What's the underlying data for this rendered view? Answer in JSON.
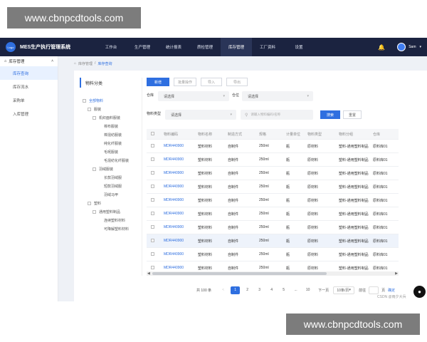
{
  "watermark": "www.cbnpcdtools.com",
  "app": {
    "logo": "Logo",
    "title": "MES生产执行管理系统"
  },
  "nav": {
    "tabs": [
      "工作台",
      "生产管理",
      "统计报表",
      "质检管理",
      "库存管理",
      "工厂资料",
      "设置"
    ],
    "active": "库存管理",
    "user": "Sam"
  },
  "sidebar": {
    "group": "库存管理",
    "items": [
      "库存查询",
      "库存流水",
      "采购单",
      "入库管理"
    ],
    "active": "库存查询"
  },
  "breadcrumb": {
    "parent": "库存管理",
    "sep": "/",
    "current": "库存查询"
  },
  "tree": {
    "title": "物料分类",
    "nodes": [
      "全部物料",
      "服装",
      "机织面料服装",
      "棉布服装",
      "棉混纺服装",
      "纯化纤服装",
      "毛呢服装",
      "毛混纺化纤服装",
      "羽绒服装",
      "长款羽绒服",
      "短款羽绒服",
      "羽绒马甲",
      "塑料",
      "通用塑料制品",
      "连续塑料材料",
      "可降解塑料材料"
    ]
  },
  "actions": {
    "add": "新增",
    "batch": "批量操作",
    "import": "导入",
    "export": "导出"
  },
  "filters": {
    "warehouse_label": "仓库",
    "warehouse_value": "请选择",
    "location_label": "仓位",
    "location_value": "请选择",
    "type_label": "物料类型",
    "type_value": "请选择",
    "search_placeholder": "请输入物料编码/名称",
    "search_btn": "搜索",
    "reset_btn": "重置"
  },
  "table": {
    "headers": [
      "物料编码",
      "物料名称",
      "制造方式",
      "规格",
      "计量单位",
      "物料类型",
      "物料分组",
      "仓库"
    ],
    "rows": [
      [
        "MDR440900",
        "塑料材料",
        "自制件",
        "250ml",
        "瓶",
        "原材料",
        "塑料-通用塑料制品",
        "原料库01"
      ],
      [
        "MDR440900",
        "塑料材料",
        "自制件",
        "250ml",
        "瓶",
        "原材料",
        "塑料-通用塑料制品",
        "原料库01"
      ],
      [
        "MDR440900",
        "塑料材料",
        "自制件",
        "250ml",
        "瓶",
        "原材料",
        "塑料-通用塑料制品",
        "原料库01"
      ],
      [
        "MDR440900",
        "塑料材料",
        "自制件",
        "250ml",
        "瓶",
        "原材料",
        "塑料-通用塑料制品",
        "原料库01"
      ],
      [
        "MDR440900",
        "塑料材料",
        "自制件",
        "250ml",
        "瓶",
        "原材料",
        "塑料-通用塑料制品",
        "原料库01"
      ],
      [
        "MDR440900",
        "塑料材料",
        "自制件",
        "250ml",
        "瓶",
        "原材料",
        "塑料-通用塑料制品",
        "原料库01"
      ],
      [
        "MDR440900",
        "塑料材料",
        "自制件",
        "250ml",
        "瓶",
        "原材料",
        "塑料-通用塑料制品",
        "原料库01"
      ],
      [
        "MDR440900",
        "塑料材料",
        "自制件",
        "250ml",
        "瓶",
        "原材料",
        "塑料-通用塑料制品",
        "原料库01"
      ],
      [
        "MDR440900",
        "塑料材料",
        "自制件",
        "250ml",
        "瓶",
        "原材料",
        "塑料-通用塑料制品",
        "原料库01"
      ],
      [
        "MDR440900",
        "塑料材料",
        "自制件",
        "250ml",
        "瓶",
        "原材料",
        "塑料-通用塑料制品",
        "原料库01"
      ]
    ],
    "highlight_row": 7
  },
  "pagination": {
    "total": "共 100 条",
    "prev": "<",
    "pages": [
      "1",
      "2",
      "3",
      "4",
      "5",
      "...",
      "10"
    ],
    "active": "1",
    "next": "下一页",
    "size": "10条/页",
    "goto_label": "前往",
    "goto_unit": "页",
    "confirm": "确定"
  },
  "footer": {
    "csdn": "CSDN @雨夕大兵"
  },
  "colors": {
    "accent": "#2f6fe0",
    "nav_bg": "#1b2340",
    "link": "#2f6fe0"
  },
  "icons": {
    "bell": "bell-icon",
    "search": "search-icon",
    "chat": "chat-icon",
    "home": "home-icon"
  }
}
